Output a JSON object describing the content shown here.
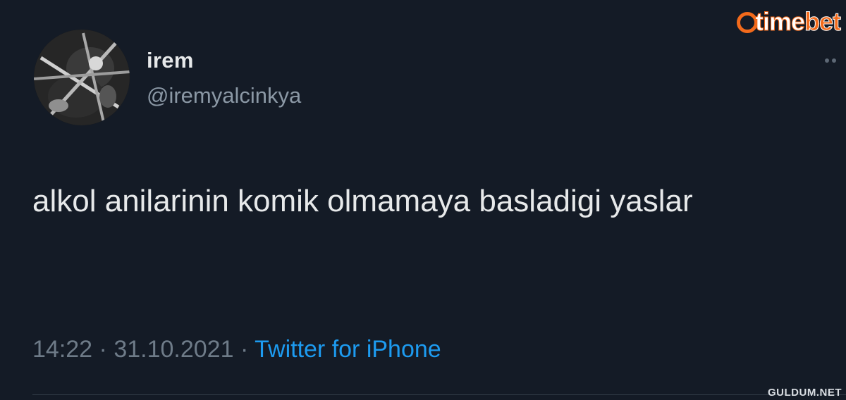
{
  "tweet": {
    "display_name": "irem",
    "handle": "@iremyalcinkya",
    "text": "alkol anilarinin komik olmamaya basladigi yaslar",
    "time": "14:22",
    "separator": "·",
    "date": "31.10.2021",
    "source": "Twitter for iPhone"
  },
  "icons": {
    "avatar": "profile-photo",
    "more": "more-icon"
  },
  "branding": {
    "logo_part_a": "time",
    "logo_part_b": "bet",
    "watermark": "GULDUM.NET"
  },
  "colors": {
    "background": "#141b26",
    "text": "#e7e9ea",
    "secondary": "#8b98a5",
    "link": "#1d9bf0",
    "brand_orange": "#f26a1b"
  }
}
